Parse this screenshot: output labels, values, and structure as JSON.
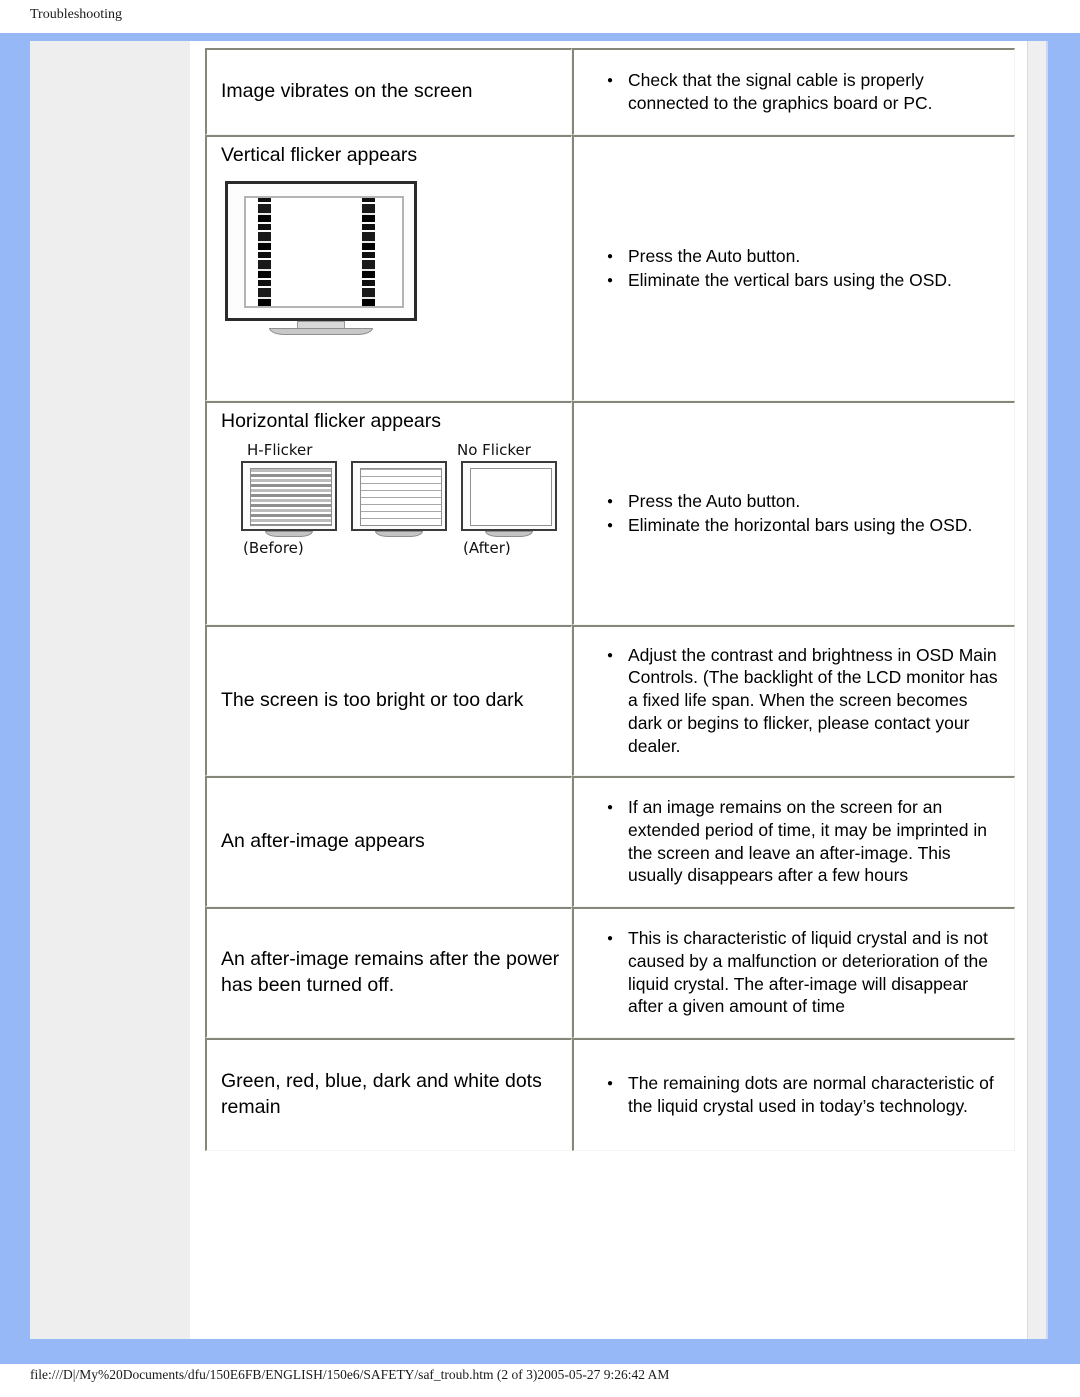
{
  "header": {
    "title": "Troubleshooting"
  },
  "footer": {
    "path": "file:///D|/My%20Documents/dfu/150E6FB/ENGLISH/150e6/SAFETY/saf_troub.htm (2 of 3)2005-05-27 9:26:42 AM"
  },
  "colors": {
    "frame_blue": "#97b8f7",
    "nav_gray": "#eeeeee",
    "cell_border": "#86867a"
  },
  "table": {
    "rows": [
      {
        "symptom": "Image vibrates on the screen",
        "solutions": [
          "Check that the signal cable is properly connected to the graphics board or PC."
        ]
      },
      {
        "symptom": "Vertical flicker appears",
        "solutions": [
          "Press the Auto button.",
          "Eliminate the vertical bars using the OSD."
        ]
      },
      {
        "symptom": "Horizontal flicker appears",
        "solutions": [
          "Press the Auto button.",
          "Eliminate the horizontal bars using the OSD."
        ]
      },
      {
        "symptom": "The screen is too bright or too dark",
        "solutions": [
          "Adjust the contrast and brightness in OSD Main Controls. (The backlight of the LCD monitor has a fixed life span. When the screen becomes dark or begins to flicker, please contact your dealer."
        ]
      },
      {
        "symptom": "An after-image appears",
        "solutions": [
          "If an image remains on the screen for an extended period of time, it may be imprinted in the screen and leave an after-image. This usually disappears after a few hours"
        ]
      },
      {
        "symptom": "An after-image remains after the power has been turned off.",
        "solutions": [
          "This is characteristic of liquid crystal and is not caused by a malfunction or deterioration of the liquid crystal. The after-image will disappear after a given amount of time"
        ]
      },
      {
        "symptom": "Green, red, blue, dark and white dots remain",
        "solutions": [
          "The remaining dots are normal characteristic of the liquid crystal used in today’s technology."
        ]
      }
    ]
  },
  "figures": {
    "vertical_flicker": {
      "alt": "LCD monitor showing two vertical flickering bars"
    },
    "horizontal_flicker": {
      "label_before_top": "H-Flicker",
      "label_after_top": "No Flicker",
      "label_before_bottom": "(Before)",
      "label_after_bottom": "(After)"
    }
  }
}
